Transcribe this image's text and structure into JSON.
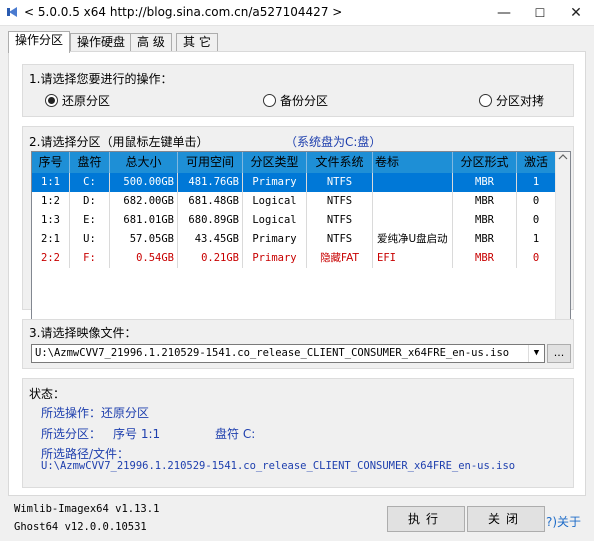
{
  "window": {
    "title": "< 5.0.0.5 x64 http://blog.sina.com.cn/a527104427 >",
    "minimize": "—",
    "maximize": "☐",
    "close": "✕"
  },
  "tabs": [
    "操作分区",
    "操作硬盘",
    "高 级",
    "其 它"
  ],
  "operation": {
    "label": "1.请选择您要进行的操作：",
    "options": [
      "还原分区",
      "备份分区",
      "分区对拷"
    ],
    "selected": "还原分区"
  },
  "partition": {
    "label": "2.请选择分区（用鼠标左键单击）",
    "system_disk_note": "（系统盘为C:盘）",
    "columns": [
      "序号",
      "盘符",
      "总大小",
      "可用空间",
      "分区类型",
      "文件系统",
      "卷标",
      "分区形式",
      "激活"
    ],
    "rows": [
      [
        "1:1",
        "C:",
        "500.00GB",
        "481.76GB",
        "Primary",
        "NTFS",
        "",
        "MBR",
        "1"
      ],
      [
        "1:2",
        "D:",
        "682.00GB",
        "681.48GB",
        "Logical",
        "NTFS",
        "",
        "MBR",
        "0"
      ],
      [
        "1:3",
        "E:",
        "681.01GB",
        "680.89GB",
        "Logical",
        "NTFS",
        "",
        "MBR",
        "0"
      ],
      [
        "2:1",
        "U:",
        "57.05GB",
        "43.45GB",
        "Primary",
        "NTFS",
        "爱纯净U盘启动",
        "MBR",
        "1"
      ],
      [
        "2:2",
        "F:",
        "0.54GB",
        "0.21GB",
        "Primary",
        "隐藏FAT",
        "EFI",
        "MBR",
        "0"
      ]
    ],
    "selected_row": 0,
    "hidden_row": 4
  },
  "image_file": {
    "label": "3.请选择映像文件：",
    "value": "U:\\AzmwCVV7_21996.1.210529-1541.co_release_CLIENT_CONSUMER_x64FRE_en-us.iso",
    "browse": "..."
  },
  "status": {
    "label": "状态：",
    "operation": "所选操作：还原分区",
    "partition_label": "所选分区：",
    "partition_no": "序号 1:1",
    "drive": "盘符 C:",
    "path_label": "所选路径/文件：",
    "path": "U:\\AzmwCVV7_21996.1.210529-1541.co_release_CLIENT_CONSUMER_x64FRE_en-us.iso"
  },
  "footer": {
    "wimlib": "Wimlib-Imagex64 v1.13.1",
    "ghost": "Ghost64 v12.0.0.10531",
    "execute": "执行",
    "close": "关闭",
    "about": "?)关于"
  },
  "colors": {
    "header_blue": "#1e8fd6",
    "selection_blue": "#0078d7",
    "note_blue": "#1e3fae",
    "hidden_red": "#c80000"
  }
}
